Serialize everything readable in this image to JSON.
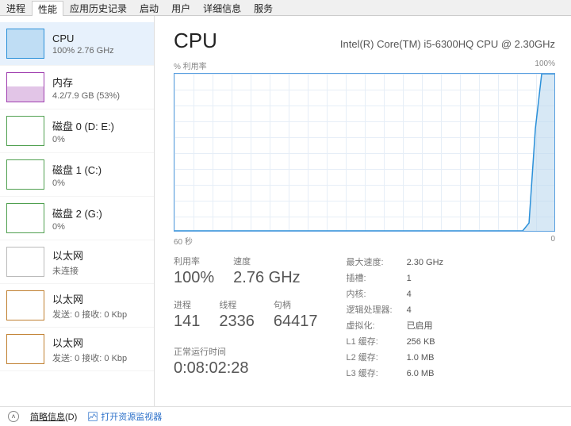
{
  "tabs": [
    "进程",
    "性能",
    "应用历史记录",
    "启动",
    "用户",
    "详细信息",
    "服务"
  ],
  "active_tab_index": 1,
  "sidebar": [
    {
      "title": "CPU",
      "sub": "100%  2.76 GHz",
      "color": "#2b90d9",
      "fill": 100
    },
    {
      "title": "内存",
      "sub": "4.2/7.9 GB (53%)",
      "color": "#a040b0",
      "fill": 53
    },
    {
      "title": "磁盘 0 (D: E:)",
      "sub": "0%",
      "color": "#50a050",
      "fill": 0
    },
    {
      "title": "磁盘 1 (C:)",
      "sub": "0%",
      "color": "#50a050",
      "fill": 0
    },
    {
      "title": "磁盘 2 (G:)",
      "sub": "0%",
      "color": "#50a050",
      "fill": 0
    },
    {
      "title": "以太网",
      "sub": "未连接",
      "color": "#bbbbbb",
      "fill": 0
    },
    {
      "title": "以太网",
      "sub": "发送: 0 接收: 0 Kbp",
      "color": "#c08030",
      "fill": 0
    },
    {
      "title": "以太网",
      "sub": "发送: 0 接收: 0 Kbp",
      "color": "#c08030",
      "fill": 0
    }
  ],
  "header": {
    "title": "CPU",
    "model": "Intel(R) Core(TM) i5-6300HQ CPU @ 2.30GHz"
  },
  "axis_top": {
    "left": "% 利用率",
    "right": "100%"
  },
  "axis_bottom": {
    "left": "60 秒",
    "right": "0"
  },
  "stats_primary": [
    {
      "label": "利用率",
      "value": "100%"
    },
    {
      "label": "速度",
      "value": "2.76 GHz"
    }
  ],
  "stats_secondary": [
    {
      "label": "进程",
      "value": "141"
    },
    {
      "label": "线程",
      "value": "2336"
    },
    {
      "label": "句柄",
      "value": "64417"
    }
  ],
  "uptime": {
    "label": "正常运行时间",
    "value": "0:08:02:28"
  },
  "specs": [
    {
      "label": "最大速度:",
      "value": "2.30 GHz"
    },
    {
      "label": "插槽:",
      "value": "1"
    },
    {
      "label": "内核:",
      "value": "4"
    },
    {
      "label": "逻辑处理器:",
      "value": "4"
    },
    {
      "label": "虚拟化:",
      "value": "已启用"
    },
    {
      "label": "L1 缓存:",
      "value": "256 KB"
    },
    {
      "label": "L2 缓存:",
      "value": "1.0 MB"
    },
    {
      "label": "L3 缓存:",
      "value": "6.0 MB"
    }
  ],
  "footer": {
    "summary": "简略信息",
    "summary_hotkey": "(D)",
    "resmon": "打开资源监视器"
  },
  "chart_data": {
    "type": "line",
    "title": "% 利用率",
    "xlabel": "秒",
    "ylabel": "%",
    "xlim": [
      60,
      0
    ],
    "ylim": [
      0,
      100
    ],
    "x": [
      60,
      55,
      50,
      45,
      40,
      35,
      30,
      25,
      20,
      15,
      10,
      5,
      4,
      3,
      2,
      1,
      0
    ],
    "values": [
      0,
      0,
      0,
      0,
      0,
      0,
      0,
      0,
      0,
      0,
      0,
      0,
      5,
      65,
      100,
      100,
      100
    ]
  }
}
